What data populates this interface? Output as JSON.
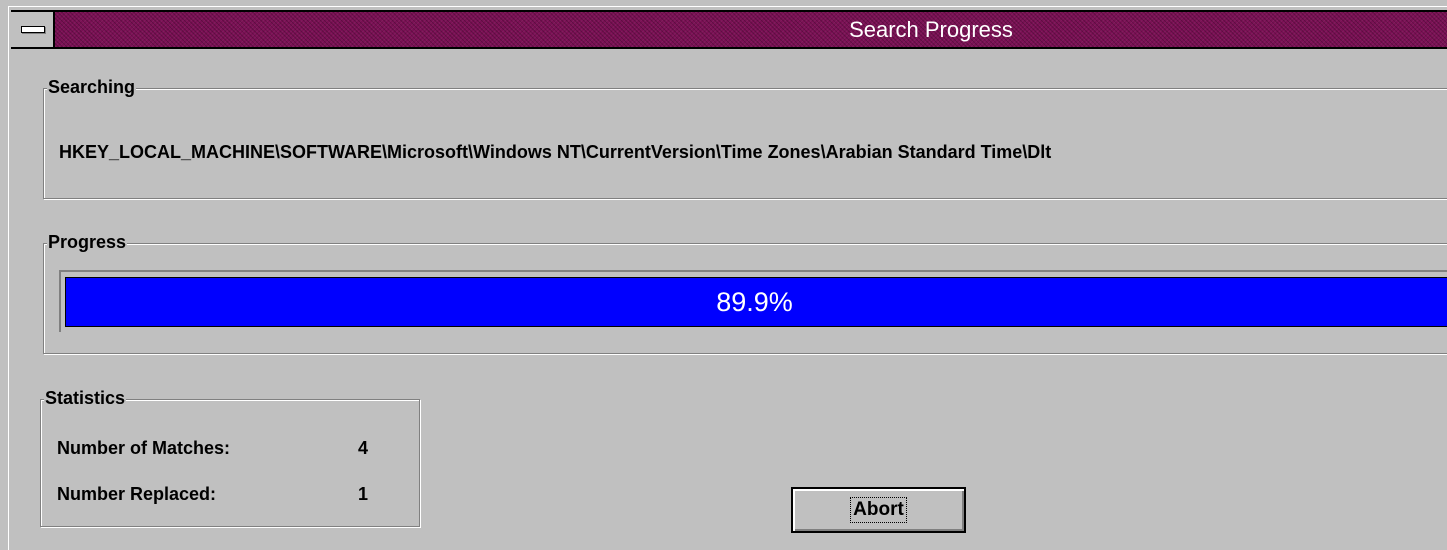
{
  "window": {
    "title": "Search Progress"
  },
  "searching": {
    "label": "Searching",
    "path": "HKEY_LOCAL_MACHINE\\SOFTWARE\\Microsoft\\Windows NT\\CurrentVersion\\Time Zones\\Arabian Standard Time\\Dlt"
  },
  "progress": {
    "label": "Progress",
    "percent_text": "89.9%",
    "value_percent": 89.9,
    "color": "#0000ff"
  },
  "statistics": {
    "label": "Statistics",
    "matches_label": "Number of Matches:",
    "matches_value": "4",
    "replaced_label": "Number Replaced:",
    "replaced_value": "1"
  },
  "buttons": {
    "abort_label": "Abort"
  },
  "icons": {
    "system_menu": "system-menu-icon"
  }
}
